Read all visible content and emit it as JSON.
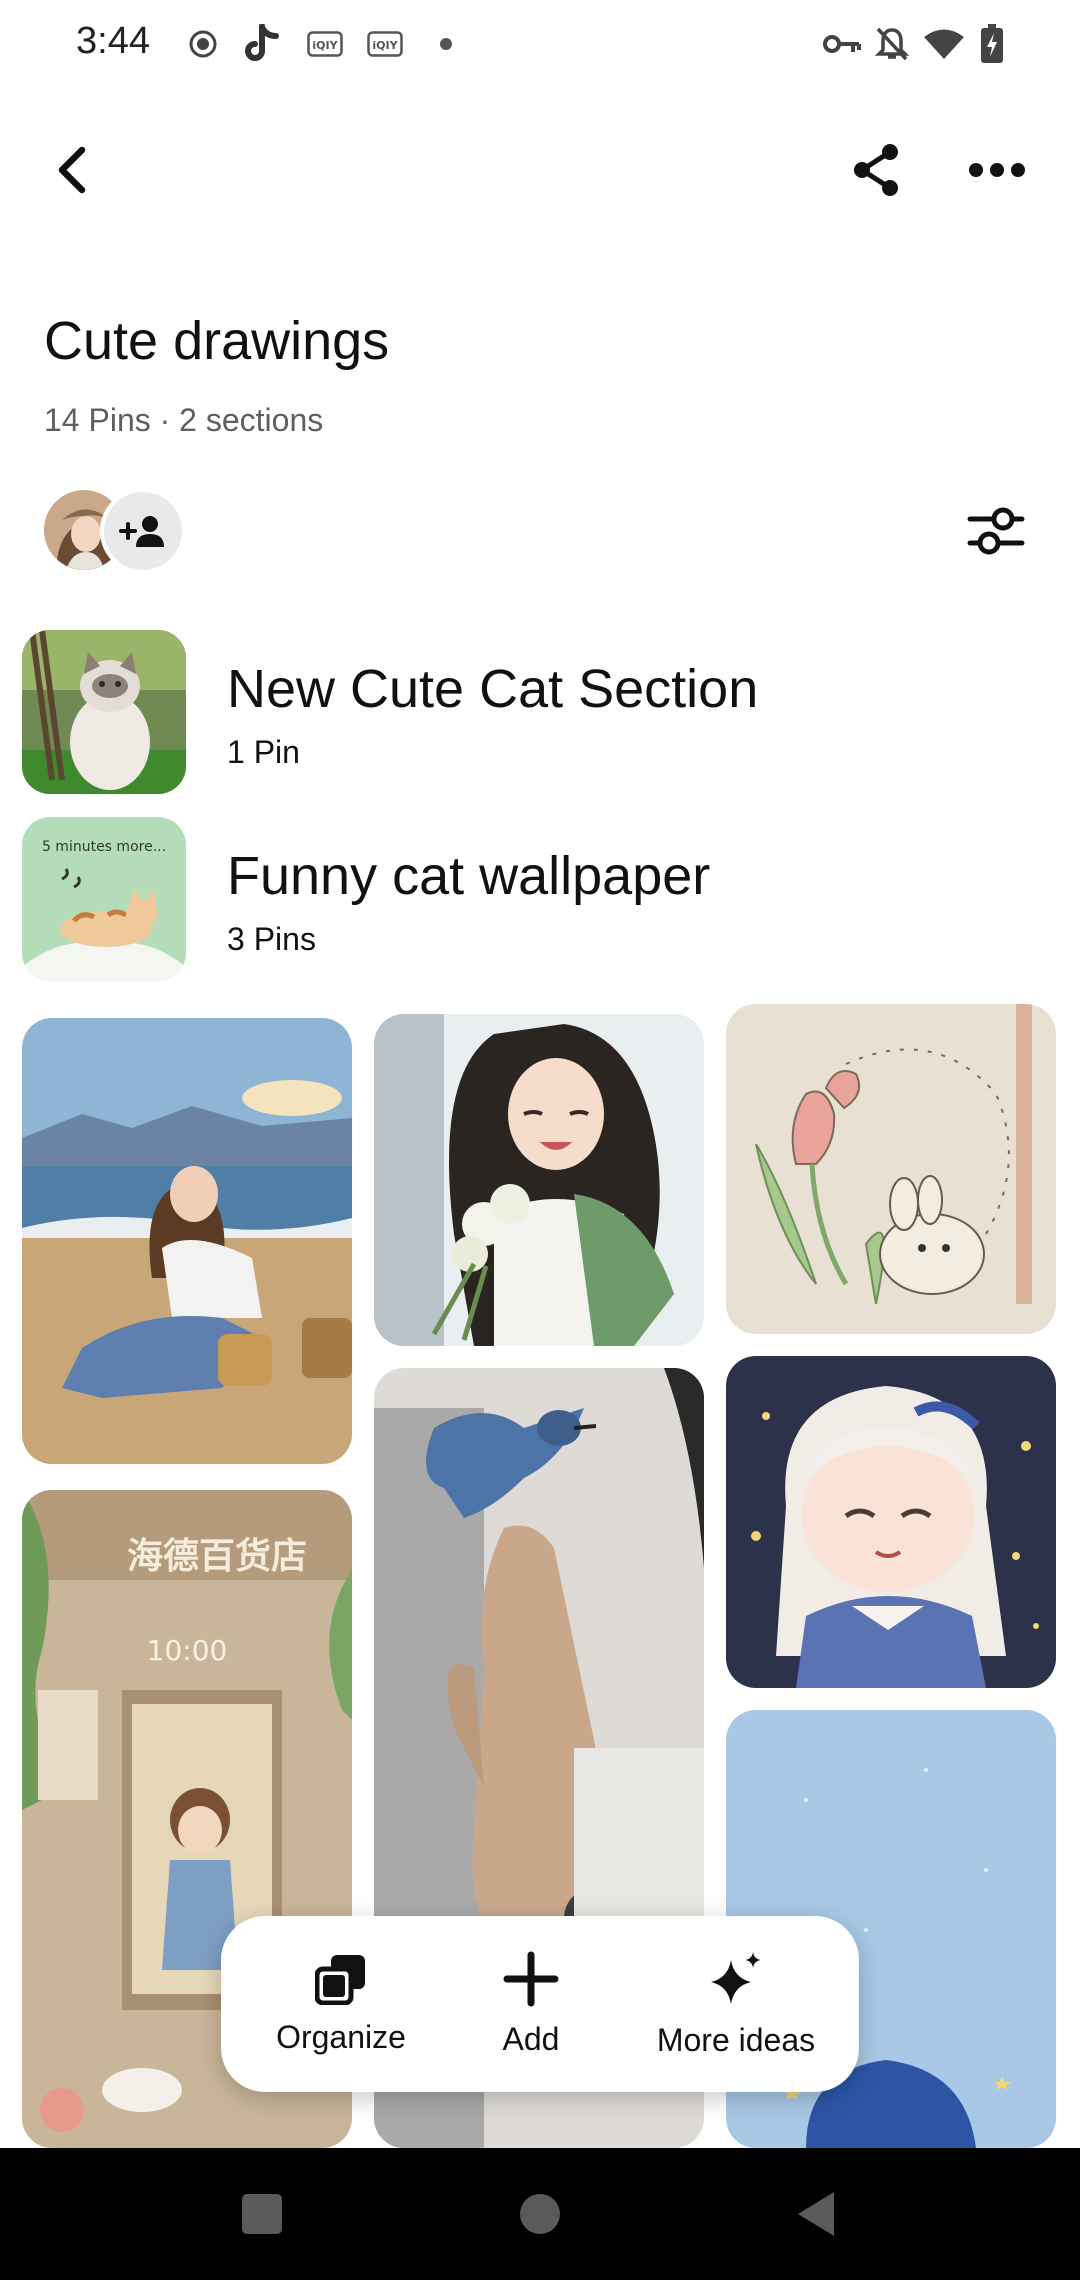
{
  "status_bar": {
    "time": "3:44",
    "left_icons": [
      "record-icon",
      "tiktok-icon",
      "iqiyi-icon",
      "iqiyi-icon",
      "dot-icon"
    ],
    "right_icons": [
      "vpn-key-icon",
      "notifications-off-icon",
      "wifi-icon",
      "battery-charging-icon"
    ]
  },
  "top_bar": {
    "back_icon": "chevron-left-icon",
    "share_icon": "share-icon",
    "more_icon": "more-horizontal-icon"
  },
  "board": {
    "title": "Cute drawings",
    "meta": "14 Pins · 2 sections"
  },
  "sections": [
    {
      "name": "New Cute Cat Section",
      "count": "1 Pin"
    },
    {
      "name": "Funny cat wallpaper",
      "count": "3 Pins"
    }
  ],
  "thumb_text": {
    "funny_cat": "5 minutes more..."
  },
  "pin_text": {
    "store_sign": "海德百货店",
    "clock": "10:00"
  },
  "action_bar": {
    "organize": "Organize",
    "add": "Add",
    "more_ideas": "More ideas"
  },
  "colors": {
    "accent_text": "#111111",
    "meta_text": "#5f5f5f",
    "chip_bg": "#e9e9e9",
    "nav_bar": "#000000"
  }
}
